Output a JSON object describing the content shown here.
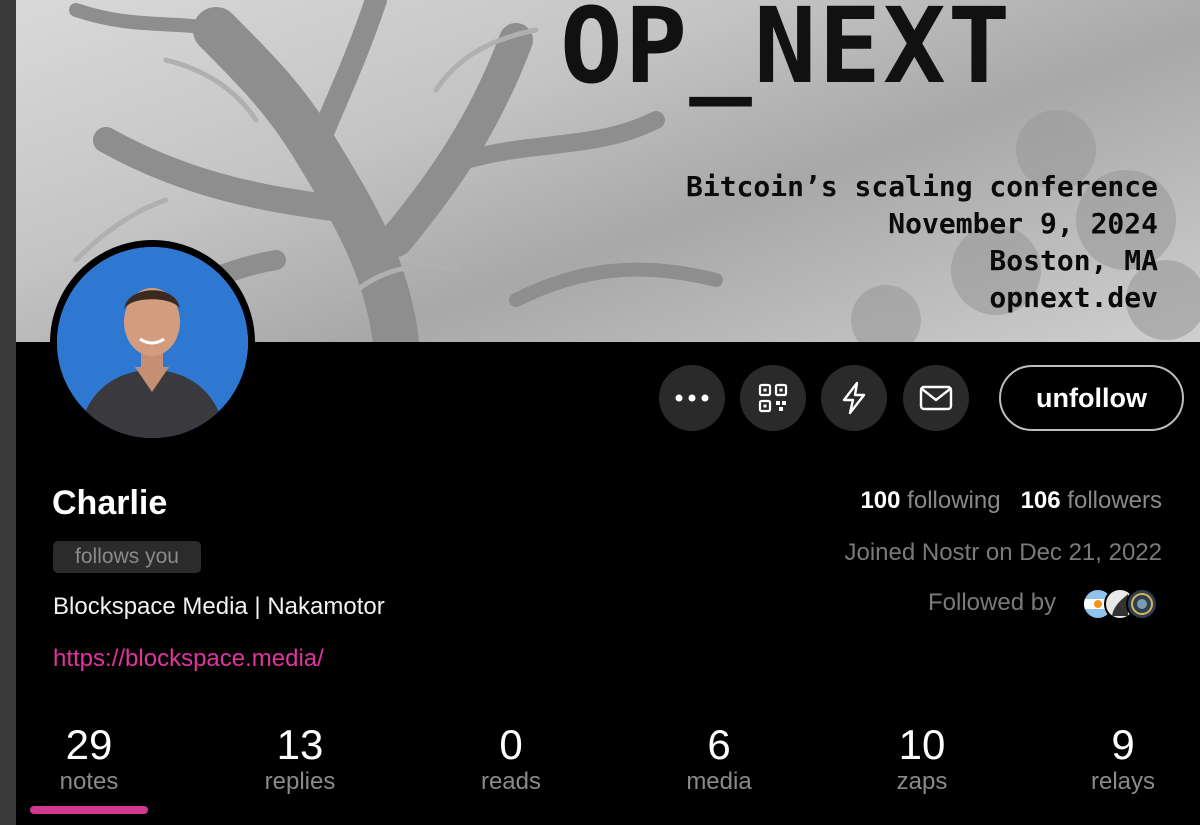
{
  "banner": {
    "logo_text": "OP_NEXT",
    "lines": [
      "Bitcoin’s scaling conference",
      "November 9, 2024",
      "Boston, MA",
      "opnext.dev"
    ]
  },
  "actions": {
    "more_icon": "more-horizontal-icon",
    "qr_icon": "qr-code-icon",
    "zap_icon": "lightning-icon",
    "message_icon": "mail-icon",
    "unfollow_label": "unfollow"
  },
  "profile": {
    "name": "Charlie",
    "follows_you": "follows you",
    "about": "Blockspace Media | Nakamotor",
    "website": "https://blockspace.media/"
  },
  "stats": {
    "following_count": "100",
    "following_label": "following",
    "followers_count": "106",
    "followers_label": "followers",
    "joined": "Joined Nostr on Dec 21, 2022",
    "followed_by": "Followed by"
  },
  "tabs": [
    {
      "count": "29",
      "label": "notes"
    },
    {
      "count": "13",
      "label": "replies"
    },
    {
      "count": "0",
      "label": "reads"
    },
    {
      "count": "6",
      "label": "media"
    },
    {
      "count": "10",
      "label": "zaps"
    },
    {
      "count": "9",
      "label": "relays"
    }
  ],
  "colors": {
    "accent": "#d1388f",
    "link": "#e0349f",
    "background": "#000000",
    "button_bg": "#2a2a2a"
  }
}
